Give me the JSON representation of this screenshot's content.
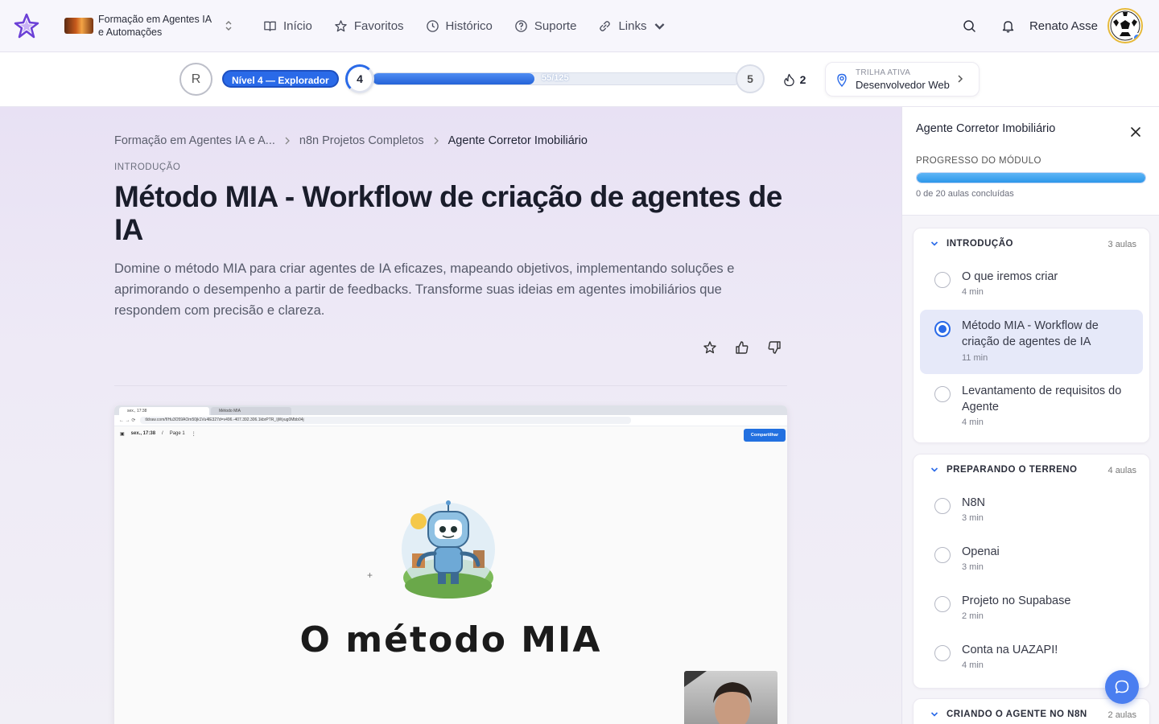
{
  "nav": {
    "course_name": "Formação em Agentes IA e Automações",
    "links": [
      {
        "label": "Início",
        "icon": "book-open-icon"
      },
      {
        "label": "Favoritos",
        "icon": "star-icon"
      },
      {
        "label": "Histórico",
        "icon": "clock-icon"
      },
      {
        "label": "Suporte",
        "icon": "help-circle-icon"
      },
      {
        "label": "Links",
        "icon": "link-icon"
      }
    ],
    "username": "Renato Asse"
  },
  "status": {
    "user_initial": "R",
    "level_label": "Nível 4 — Explorador",
    "current_level": "4",
    "next_level": "5",
    "xp_text": "55/125",
    "xp_fraction": 0.44,
    "streak": "2",
    "track_label": "TRILHA ATIVA",
    "track_value": "Desenvolvedor Web"
  },
  "lesson": {
    "breadcrumb": [
      "Formação em Agentes IA e A...",
      "n8n Projetos Completos",
      "Agente Corretor Imobiliário"
    ],
    "section": "INTRODUÇÃO",
    "title": "Método MIA - Workflow de criação de agentes de IA",
    "description": "Domine o método MIA para criar agentes de IA eficazes, mapeando objetivos, implementando soluções e aprimorando o desempenho a partir de feedbacks. Transforme suas ideias em agentes imobiliários que respondem com precisão e clareza."
  },
  "video": {
    "tab1": "sex., 17:38",
    "tab2": "Método MIA",
    "url": "tldraw.com/f/Hu3O59AOm50jk1Vu4lE327d=v496.-407.392.306.1kbrPTR_IjWyug0Mbb04j",
    "page_date": "sex., 17:38",
    "page_name": "Page 1",
    "share_label": "Compartilhar",
    "slide_text": "O método MIA"
  },
  "sidebar": {
    "title": "Agente Corretor Imobiliário",
    "progress_label": "PROGRESSO DO MÓDULO",
    "progress_text": "0 de 20 aulas concluídas",
    "progress_fraction": 1.0,
    "modules": [
      {
        "title": "INTRODUÇÃO",
        "count": "3 aulas",
        "lessons": [
          {
            "title": "O que iremos criar",
            "duration": "4 min"
          },
          {
            "title": "Método MIA - Workflow de criação de agentes de IA",
            "duration": "11 min"
          },
          {
            "title": "Levantamento de requisitos do Agente",
            "duration": "4 min"
          }
        ]
      },
      {
        "title": "PREPARANDO O TERRENO",
        "count": "4 aulas",
        "lessons": [
          {
            "title": "N8N",
            "duration": "3 min"
          },
          {
            "title": "Openai",
            "duration": "3 min"
          },
          {
            "title": "Projeto no Supabase",
            "duration": "2 min"
          },
          {
            "title": "Conta na UAZAPI!",
            "duration": "4 min"
          }
        ]
      },
      {
        "title": "CRIANDO O AGENTE NO N8N",
        "count": "2 aulas",
        "lessons": []
      }
    ]
  },
  "colors": {
    "accent": "#2a6ae8",
    "progress": "#2d97ea"
  }
}
